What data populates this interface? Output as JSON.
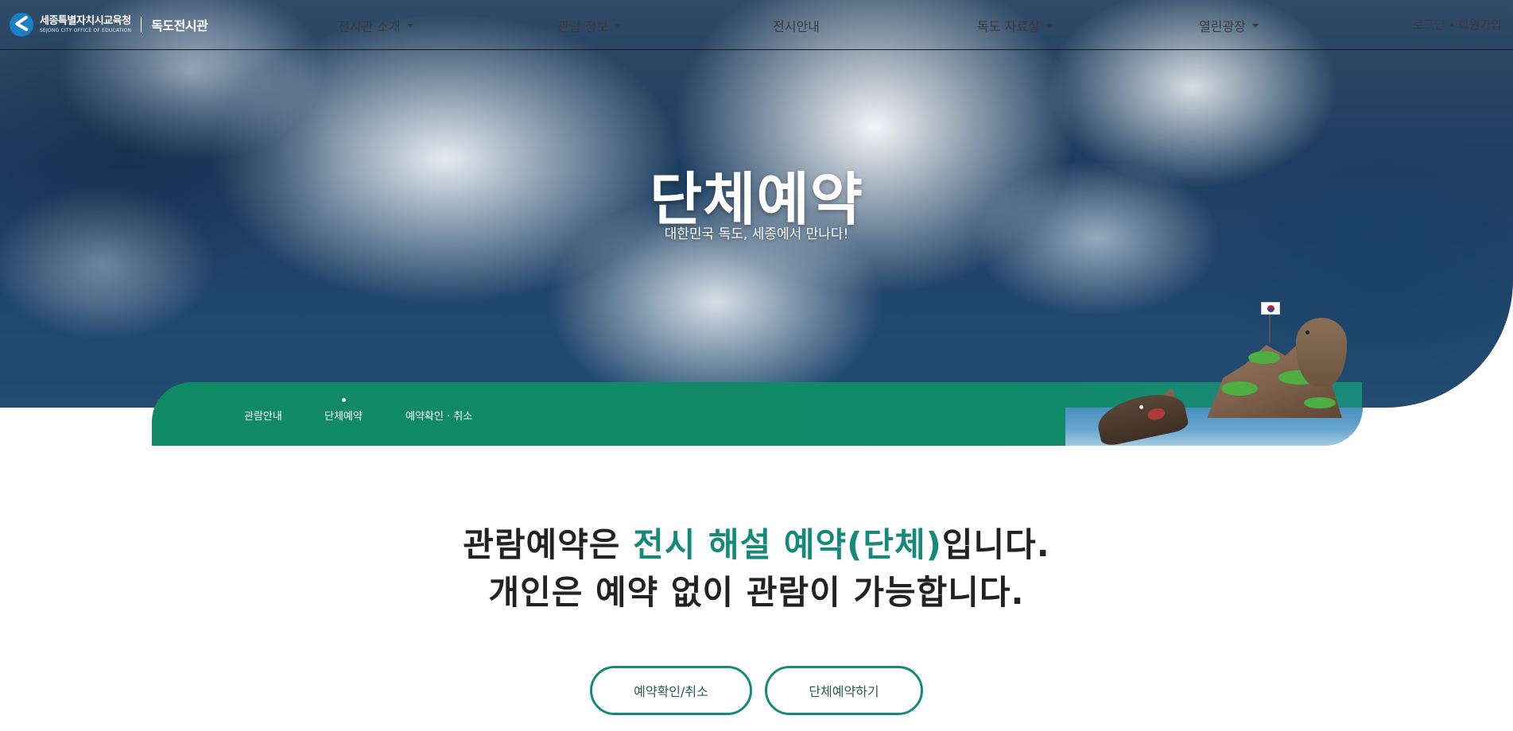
{
  "header": {
    "logo_org": "세종특별자치시교육청",
    "logo_org_en": "SEJONG CITY OFFICE OF EDUCATION",
    "site_name": "독도전시관"
  },
  "nav": {
    "items": [
      {
        "label": "전시관 소개",
        "dropdown": true
      },
      {
        "label": "관람 정보",
        "dropdown": true
      },
      {
        "label": "전시안내",
        "dropdown": false
      },
      {
        "label": "독도 자료실",
        "dropdown": true
      },
      {
        "label": "열린광장",
        "dropdown": true
      }
    ],
    "login_label": "로그인",
    "signup_label": "회원가입"
  },
  "hero": {
    "title": "단체예약",
    "subtitle": "대한민국 독도, 세종에서 만나다!"
  },
  "subnav": {
    "tabs": [
      {
        "label": "관람안내",
        "active": false
      },
      {
        "label": "단체예약",
        "active": true
      },
      {
        "label": "예약확인 · 취소",
        "active": false
      }
    ]
  },
  "main": {
    "line1_prefix": "관람예약은 ",
    "line1_accent": "전시 해설 예약(단체)",
    "line1_suffix": "입니다.",
    "line2": "개인은 예약 없이 관람이 가능합니다.",
    "buttons": {
      "check_cancel": "예약확인/취소",
      "group_reserve": "단체예약하기"
    }
  },
  "colors": {
    "accent_green": "#0f8a63",
    "accent_teal": "#168a7a"
  }
}
